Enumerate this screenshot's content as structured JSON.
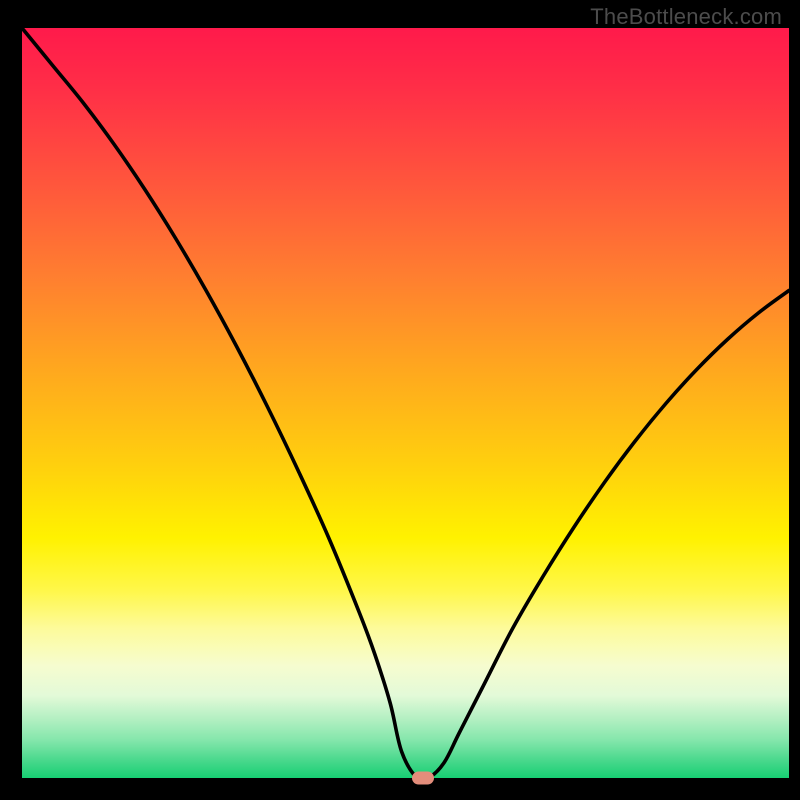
{
  "watermark": "TheBottleneck.com",
  "chart_data": {
    "type": "line",
    "title": "",
    "xlabel": "",
    "ylabel": "",
    "xlim": [
      0,
      100
    ],
    "ylim": [
      0,
      100
    ],
    "series": [
      {
        "name": "bottleneck-curve",
        "x": [
          0,
          4,
          8,
          12,
          16,
          20,
          24,
          28,
          32,
          36,
          40,
          44,
          46,
          48,
          49.5,
          51.5,
          53,
          55,
          57,
          60,
          64,
          68,
          72,
          76,
          80,
          84,
          88,
          92,
          96,
          100
        ],
        "values": [
          100,
          95,
          90,
          84.5,
          78.5,
          72,
          65,
          57.5,
          49.5,
          41,
          32,
          22,
          16.5,
          10,
          3.5,
          0,
          0,
          2,
          6,
          12,
          20,
          27,
          33.5,
          39.5,
          45,
          50,
          54.5,
          58.5,
          62,
          65
        ]
      }
    ],
    "marker": {
      "x": 52.3,
      "y": 0
    },
    "grid": false,
    "legend": false,
    "colors": {
      "curve": "#000000",
      "marker": "#e38d7b",
      "gradient_top": "#ff1a4b",
      "gradient_bottom": "#17cf73"
    }
  }
}
